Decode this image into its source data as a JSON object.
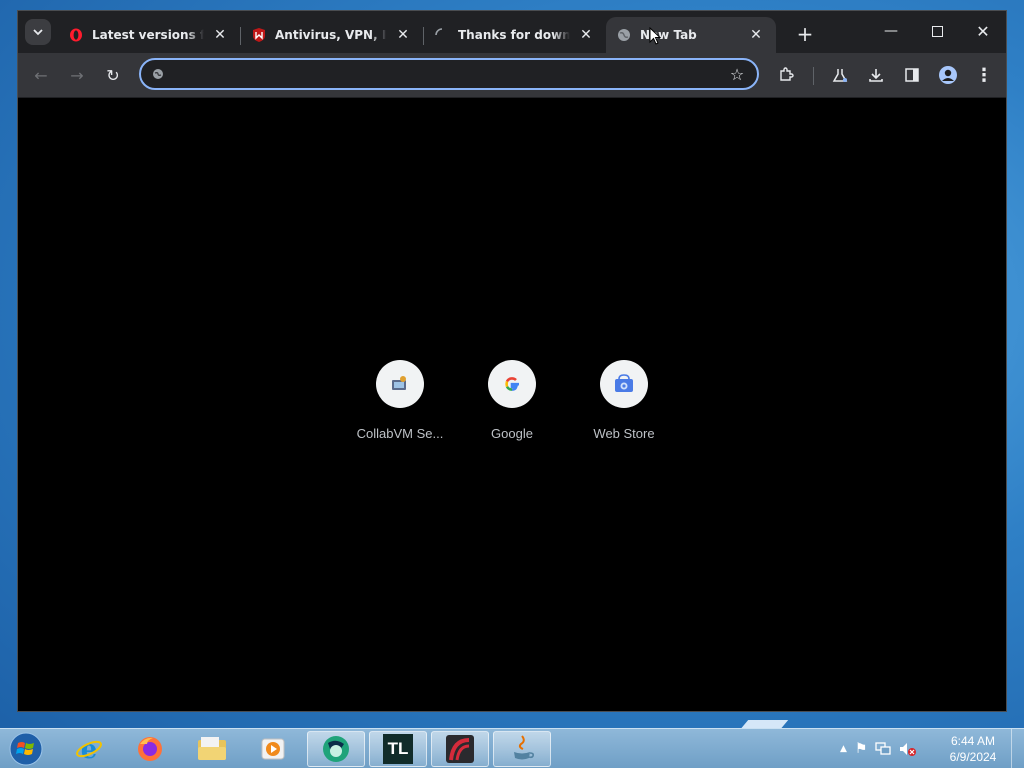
{
  "browser": {
    "tabs": [
      {
        "title": "Latest versions for W",
        "favicon": "opera-icon",
        "active": false
      },
      {
        "title": "Antivirus, VPN, Iden",
        "favicon": "mcafee-icon",
        "active": false
      },
      {
        "title": "Thanks for downloa",
        "favicon": "loading-spinner-icon",
        "active": false
      },
      {
        "title": "New Tab",
        "favicon": "globe-icon",
        "active": true
      }
    ],
    "omnibox": {
      "value": "",
      "placeholder": ""
    },
    "colors": {
      "frame": "#202124",
      "toolbar": "#35363a",
      "accent": "#8ab4f8",
      "content": "#000000"
    }
  },
  "newtab": {
    "shortcuts": [
      {
        "label": "CollabVM Se...",
        "icon": "collabvm-icon"
      },
      {
        "label": "Google",
        "icon": "google-g-icon"
      },
      {
        "label": "Web Store",
        "icon": "web-store-icon"
      }
    ]
  },
  "taskbar": {
    "items": [
      "internet-explorer-icon",
      "firefox-icon",
      "file-explorer-icon",
      "media-player-icon",
      "app-green-icon",
      "tl-app-icon",
      "red-app-icon",
      "java-icon"
    ],
    "tl_label": "TL",
    "clock": {
      "time": "6:44 AM",
      "date": "6/9/2024"
    }
  }
}
